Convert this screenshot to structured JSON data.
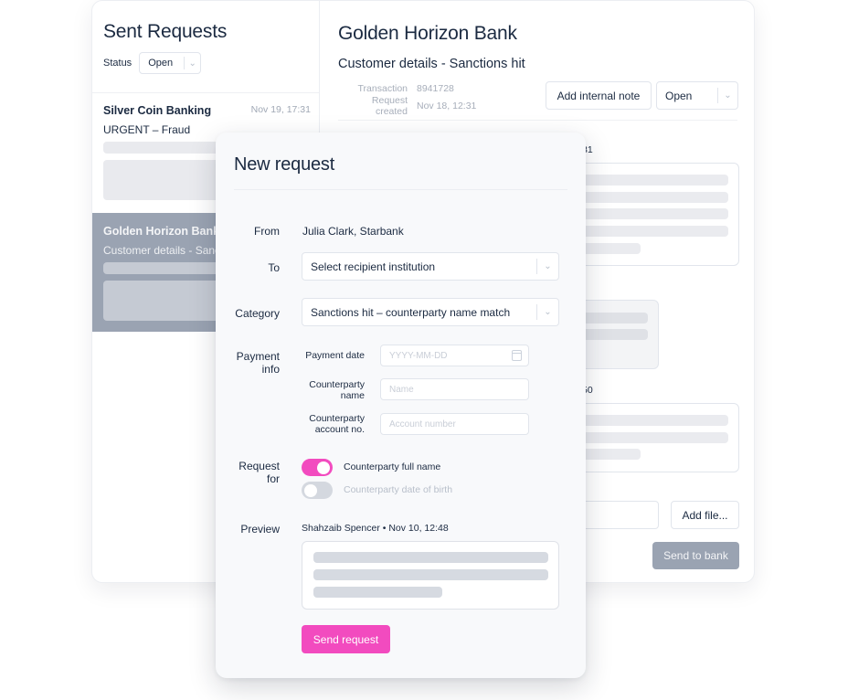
{
  "sidebar": {
    "title": "Sent Requests",
    "status_label": "Status",
    "status_value": "Open",
    "requests": [
      {
        "bank": "Silver Coin Banking",
        "time": "Nov 19, 17:31",
        "subject": "URGENT – Fraud",
        "selected": false
      },
      {
        "bank": "Golden Horizon Bank",
        "subject": "Customer details - Sanctions hit",
        "selected": true
      }
    ]
  },
  "detail": {
    "title": "Golden Horizon Bank",
    "subtitle": "Customer details - Sanctions hit",
    "meta": [
      {
        "key": "Transaction",
        "value": "8941728"
      },
      {
        "key": "Request created",
        "value": "Nov 18, 12:31"
      }
    ],
    "add_note_label": "Add internal note",
    "status_value": "Open",
    "messages": [
      {
        "time_fragment": "31"
      },
      {
        "time_fragment": "50"
      }
    ],
    "add_file_label": "Add file...",
    "send_label": "Send to bank"
  },
  "modal": {
    "title": "New request",
    "from_label": "From",
    "from_value": "Julia Clark, Starbank",
    "to_label": "To",
    "to_value": "Select recipient institution",
    "category_label": "Category",
    "category_value": "Sanctions hit – counterparty name match",
    "payment_info_label": "Payment info",
    "payment_fields": [
      {
        "label": "Payment date",
        "placeholder": "YYYY-MM-DD",
        "icon": "calendar-icon"
      },
      {
        "label": "Counterparty name",
        "placeholder": "Name"
      },
      {
        "label": "Counterparty account no.",
        "placeholder": "Account number"
      }
    ],
    "request_for_label": "Request for",
    "request_for_options": [
      {
        "label": "Counterparty full name",
        "enabled": true
      },
      {
        "label": "Counterparty date of birth",
        "enabled": false
      }
    ],
    "preview_label": "Preview",
    "preview_meta": "Shahzaib Spencer • Nov 10, 12:48",
    "send_label": "Send request"
  },
  "colors": {
    "accent": "#f24bbf",
    "selected_row": "#9aa3b2",
    "text": "#1b2a41",
    "muted": "#a7aeba"
  }
}
